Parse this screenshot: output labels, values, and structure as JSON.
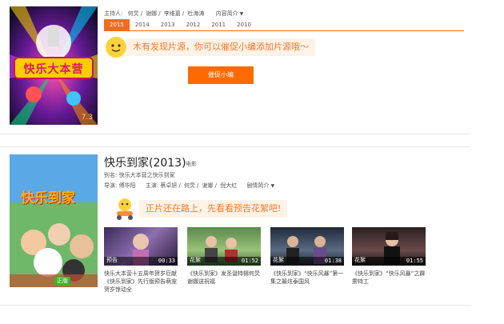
{
  "show1": {
    "hosts_label": "主持人:",
    "hosts": [
      "何炅",
      "谢娜",
      "李维嘉",
      "杜海涛"
    ],
    "intro_label": "内容简介",
    "years": [
      "2015",
      "2014",
      "2013",
      "2012",
      "2011",
      "2010"
    ],
    "active_year": "2015",
    "notice": "木有发现片源，你可以催促小编添加片源哦～",
    "urge_button": "催促小编",
    "rating": "7.3",
    "poster_text": "快乐大本营"
  },
  "show2": {
    "title": "快乐到家(2013)",
    "type": "电影",
    "alias_label": "别名:",
    "alias": "快乐大本营之快乐到家",
    "director_label": "导演:",
    "director": "傅华阳",
    "cast_label": "主演:",
    "cast": [
      "蔡卓妍",
      "何炅",
      "谢娜",
      "倪大红"
    ],
    "plot_label": "剧情简介",
    "notice": "正片还在路上，先看看预告花絮吧!",
    "poster_text": "快乐到家",
    "hd_badge": "正版",
    "clips": [
      {
        "label": "预告",
        "duration": "00:33",
        "title": "快乐大本营十五周年贺岁巨献《快乐到家》先行版预告萌宠贺岁惊动全"
      },
      {
        "label": "花絮",
        "duration": "01:52",
        "title": "《快乐到家》发圣诞特辑何炅谢娜送祝福"
      },
      {
        "label": "花絮",
        "duration": "01:38",
        "title": "《快乐到家》“快乐风暴”第一集之最炫泰国风"
      },
      {
        "label": "花絮",
        "duration": "01:55",
        "title": "《快乐到家》“快乐风暴”之霹雳特工"
      }
    ]
  },
  "colors": {
    "accent": "#f26b1f",
    "button": "#ff6a00",
    "notice_text": "#f07a2a",
    "notice_bg": "#fff3e8"
  }
}
